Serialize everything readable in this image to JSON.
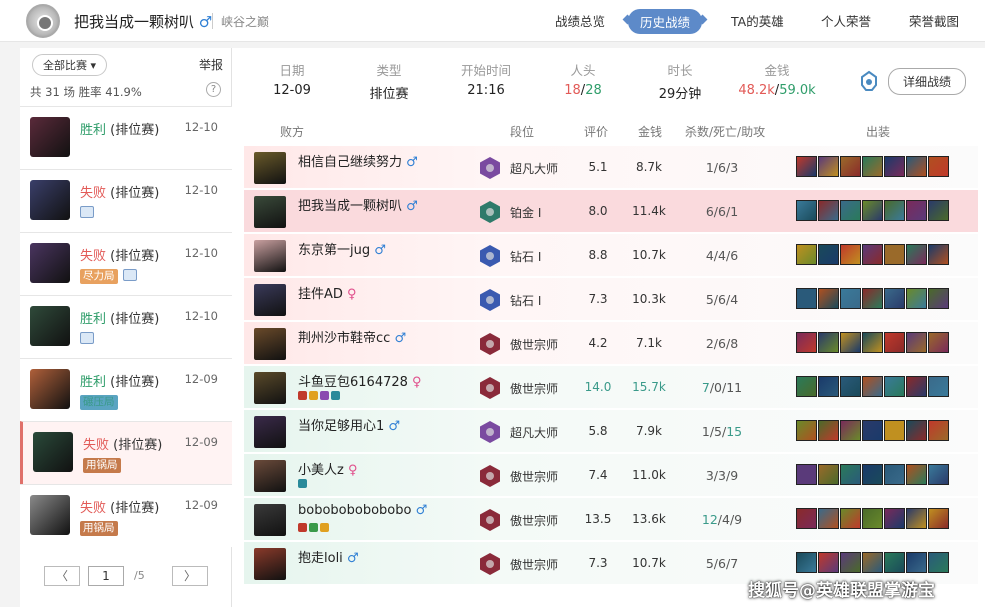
{
  "header": {
    "username": "把我当成一颗树叭",
    "username_gender": "♂",
    "server": "峡谷之巅",
    "nav": [
      {
        "label": "战绩总览",
        "active": false
      },
      {
        "label": "历史战绩",
        "active": true
      },
      {
        "label": "TA的英雄",
        "active": false
      },
      {
        "label": "个人荣誉",
        "active": false
      },
      {
        "label": "荣誉截图",
        "active": false
      }
    ]
  },
  "sidebar": {
    "filter_label": "全部比赛 ▾",
    "report_label": "举报",
    "summary": "共 31 场   胜率 41.9%",
    "help_icon": "?",
    "matches": [
      {
        "result": "胜利",
        "outcome": "win",
        "type": " (排位赛)",
        "date": "12-10",
        "tag": "",
        "has_image": false,
        "selected": false,
        "avatar_color": "#5a2a3a"
      },
      {
        "result": "失败",
        "outcome": "lose",
        "type": " (排位赛)",
        "date": "12-10",
        "tag": "",
        "has_image": true,
        "selected": false,
        "avatar_color": "#3a3f6a"
      },
      {
        "result": "失败",
        "outcome": "lose",
        "type": " (排位赛)",
        "date": "12-10",
        "tag": "尽力局",
        "tag_color": "orange",
        "has_image": true,
        "selected": false,
        "avatar_color": "#4a3560"
      },
      {
        "result": "胜利",
        "outcome": "win",
        "type": " (排位赛)",
        "date": "12-10",
        "tag": "",
        "has_image": true,
        "selected": false,
        "avatar_color": "#2f4a3a"
      },
      {
        "result": "胜利",
        "outcome": "win",
        "type": " (排位赛)",
        "date": "12-09",
        "tag": "碾压局",
        "tag_color": "teal",
        "has_image": false,
        "selected": false,
        "avatar_color": "#b0603a"
      },
      {
        "result": "失败",
        "outcome": "lose",
        "type": " (排位赛)",
        "date": "12-09",
        "tag": "用锅局",
        "tag_color": "brown",
        "has_image": false,
        "selected": true,
        "avatar_color": "#2a4a3a"
      },
      {
        "result": "失败",
        "outcome": "lose",
        "type": " (排位赛)",
        "date": "12-09",
        "tag": "用锅局",
        "tag_color": "brown",
        "has_image": false,
        "selected": false,
        "avatar_color": "#8a8a8a",
        "badge": "SVP"
      }
    ],
    "pager": {
      "prev": "〈",
      "current": "1",
      "total": "/5",
      "next": "〉"
    }
  },
  "game_info": {
    "date_label": "日期",
    "date_value": "12-09",
    "type_label": "类型",
    "type_value": "排位赛",
    "start_label": "开始时间",
    "start_value": "21:16",
    "kills_label": "人头",
    "kills_loss": "18",
    "kills_sep": "/",
    "kills_win": "28",
    "duration_label": "时长",
    "duration_value": "29分钟",
    "gold_label": "金钱",
    "gold_loss": "48.2k",
    "gold_sep": "/",
    "gold_win": "59.0k",
    "detail_button": "详细战绩"
  },
  "table": {
    "headers": {
      "team": "败方",
      "tier": "段位",
      "score": "评价",
      "gold": "金钱",
      "kda": "杀数/死亡/助攻",
      "items": "出装"
    },
    "players": [
      {
        "name": "相信自己继续努力",
        "gender": "♂",
        "tier": "超凡大师",
        "tier_color": "#7a4aa0",
        "score": "5.1",
        "gold": "8.7k",
        "k": "1",
        "d": "6",
        "a": "3",
        "row": "loss",
        "avatar": "#6a5a2a",
        "mvp": false,
        "icons": []
      },
      {
        "name": "把我当成一颗树叭",
        "gender": "♂",
        "tier": "铂金 Ⅰ",
        "tier_color": "#2f7a6a",
        "score": "8.0",
        "gold": "11.4k",
        "k": "6",
        "d": "6",
        "a": "1",
        "row": "selrow",
        "avatar": "#3a4a3a",
        "mvp": false,
        "icons": []
      },
      {
        "name": "东京第一jug",
        "gender": "♂",
        "tier": "钻石 Ⅰ",
        "tier_color": "#3a5ab0",
        "score": "8.8",
        "gold": "10.7k",
        "k": "4",
        "d": "4",
        "a": "6",
        "row": "loss",
        "avatar": "#c9a0a0",
        "mvp": false,
        "svp": "SVP",
        "icons": []
      },
      {
        "name": "挂件AD",
        "gender": "♀",
        "tier": "钻石 Ⅰ",
        "tier_color": "#3a5ab0",
        "score": "7.3",
        "gold": "10.3k",
        "k": "5",
        "d": "6",
        "a": "4",
        "row": "loss",
        "avatar": "#3a3a5a",
        "mvp": false,
        "icons": []
      },
      {
        "name": "荆州沙市鞋帝cc",
        "gender": "♂",
        "tier": "傲世宗师",
        "tier_color": "#8a2a3a",
        "score": "4.2",
        "gold": "7.1k",
        "k": "2",
        "d": "6",
        "a": "8",
        "row": "loss",
        "avatar": "#6a4a2a",
        "mvp": false,
        "icons": []
      },
      {
        "name": "斗鱼豆包6164728",
        "gender": "♀",
        "tier": "傲世宗师",
        "tier_color": "#8a2a3a",
        "score": "14.0",
        "gold": "15.7k",
        "k": "7",
        "d": "0",
        "a": "11",
        "row": "winrow",
        "avatar": "#5a4a2a",
        "mvp": true,
        "mvp_label": "MVP",
        "icons": [
          "#c0392b",
          "#e0a020",
          "#8a4ab0",
          "#2a8a9a"
        ],
        "highlight": true
      },
      {
        "name": "当你足够用心1",
        "gender": "♂",
        "tier": "超凡大师",
        "tier_color": "#7a4aa0",
        "score": "5.8",
        "gold": "7.9k",
        "k": "1",
        "d": "5",
        "a": "15",
        "row": "winrow",
        "avatar": "#3a2a4a",
        "mvp": false,
        "icons": [],
        "a_teal": true
      },
      {
        "name": "小美人z",
        "gender": "♀",
        "tier": "傲世宗师",
        "tier_color": "#8a2a3a",
        "score": "7.4",
        "gold": "11.0k",
        "k": "3",
        "d": "3",
        "a": "9",
        "row": "winrow",
        "avatar": "#6a4a3a",
        "mvp": false,
        "icons": [
          "#2a8a9a"
        ]
      },
      {
        "name": "bobobobobobobo",
        "gender": "♂",
        "tier": "傲世宗师",
        "tier_color": "#8a2a3a",
        "score": "13.5",
        "gold": "13.6k",
        "k": "12",
        "d": "4",
        "a": "9",
        "row": "winrow",
        "avatar": "#3a3a3a",
        "mvp": false,
        "icons": [
          "#c0392b",
          "#3a9a4a",
          "#e0a020"
        ],
        "k_teal": true
      },
      {
        "name": "抱走loli",
        "gender": "♂",
        "tier": "傲世宗师",
        "tier_color": "#8a2a3a",
        "score": "7.3",
        "gold": "10.7k",
        "k": "5",
        "d": "6",
        "a": "7",
        "row": "winrow",
        "avatar": "#8a3a2a",
        "mvp": false,
        "icons": [],
        "crown": true
      }
    ]
  },
  "watermark": "搜狐号@英雄联盟掌游宝"
}
